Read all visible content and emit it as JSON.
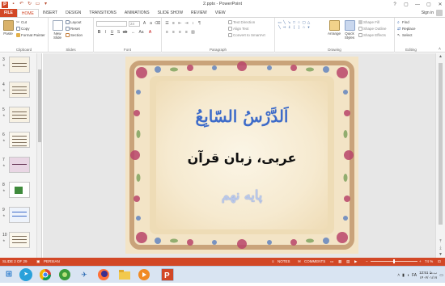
{
  "window": {
    "title": "2.pptx - PowerPoint",
    "controls": [
      "?",
      "▢",
      "—",
      "▢",
      "✕"
    ]
  },
  "tabs": [
    {
      "label": "FILE"
    },
    {
      "label": "HOME"
    },
    {
      "label": "INSERT"
    },
    {
      "label": "DESIGN"
    },
    {
      "label": "TRANSITIONS"
    },
    {
      "label": "ANIMATIONS"
    },
    {
      "label": "SLIDE SHOW"
    },
    {
      "label": "REVIEW"
    },
    {
      "label": "VIEW"
    }
  ],
  "signin": "Sign in",
  "ribbon": {
    "clipboard": {
      "label": "Clipboard",
      "paste": "Paste",
      "cut": "Cut",
      "copy": "Copy",
      "format_painter": "Format Painter"
    },
    "slides": {
      "label": "Slides",
      "new_slide": "New Slide",
      "layout": "Layout",
      "reset": "Reset",
      "section": "Section"
    },
    "font": {
      "label": "Font",
      "font_size": "24"
    },
    "paragraph": {
      "label": "Paragraph",
      "text_direction": "Text Direction",
      "align_text": "Align Text",
      "convert_smartart": "Convert to SmartArt"
    },
    "drawing": {
      "label": "Drawing",
      "arrange": "Arrange",
      "quick_styles": "Quick Styles",
      "shape_fill": "Shape Fill",
      "shape_outline": "Shape Outline",
      "shape_effects": "Shape Effects"
    },
    "editing": {
      "label": "Editing",
      "find": "Find",
      "replace": "Replace",
      "select": "Select"
    }
  },
  "slide_thumbnails": [
    {
      "number": "3"
    },
    {
      "number": "4"
    },
    {
      "number": "5"
    },
    {
      "number": "6"
    },
    {
      "number": "7"
    },
    {
      "number": "8"
    },
    {
      "number": "9"
    },
    {
      "number": "10"
    }
  ],
  "slide": {
    "title": "اَلدَّرْسُ السّابِعُ",
    "subtitle": "عربی، زبان قرآن",
    "grade": "پایه نهم"
  },
  "statusbar": {
    "slide_info": "SLIDE 2 OF 29",
    "language": "PERSIAN",
    "notes": "NOTES",
    "comments": "COMMENTS",
    "zoom": "74 %"
  },
  "taskbar": {
    "apps": [
      "start",
      "telegram",
      "chrome",
      "media",
      "bird",
      "firefox",
      "explorer",
      "media-player",
      "powerpoint"
    ],
    "time": "12:51 ب.ظ",
    "date": "۱۴۰۲/۰۱/۱۷"
  }
}
